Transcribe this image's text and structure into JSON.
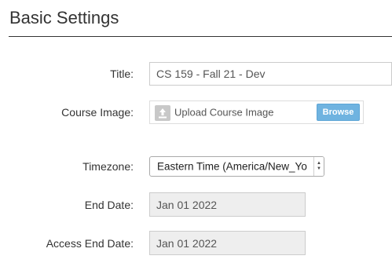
{
  "section": {
    "title": "Basic Settings"
  },
  "fields": {
    "title": {
      "label": "Title:",
      "value": "CS 159 - Fall 21 - Dev"
    },
    "course_image": {
      "label": "Course Image:",
      "upload_text": "Upload Course Image",
      "browse_label": "Browse",
      "icon": "upload-icon"
    },
    "timezone": {
      "label": "Timezone:",
      "value": "Eastern Time (America/New_Yo"
    },
    "end_date": {
      "label": "End Date:",
      "value": "Jan 01 2022"
    },
    "access_end_date": {
      "label": "Access End Date:",
      "value": "Jan 01 2022"
    }
  },
  "colors": {
    "browse_button": "#6fb3e0",
    "disabled_field": "#eeeeee"
  }
}
